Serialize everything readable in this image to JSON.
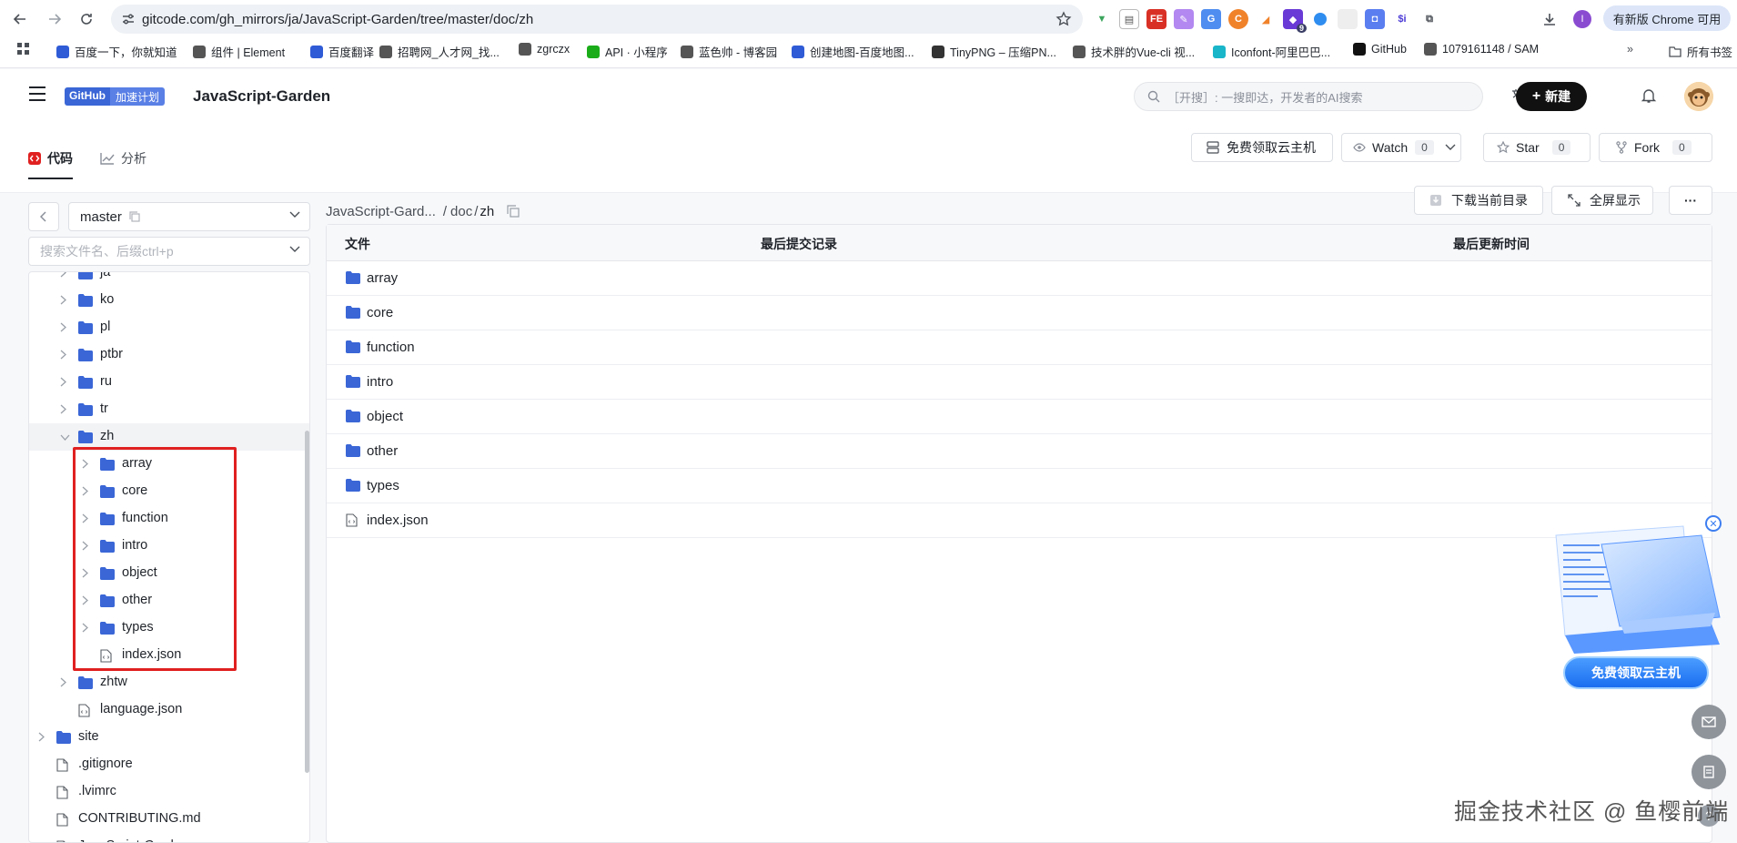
{
  "browser": {
    "url": "gitcode.com/gh_mirrors/ja/JavaScript-Garden/tree/master/doc/zh",
    "update_badge": "有新版 Chrome 可用",
    "ext_badge_count": "9",
    "bookmarks": [
      {
        "label": "百度一下，你就知道",
        "color": "#2f5bd6"
      },
      {
        "label": "组件 | Element",
        "color": "#555"
      },
      {
        "label": "百度翻译",
        "color": "#2f5bd6"
      },
      {
        "label": "招聘网_人才网_找...",
        "color": "#555"
      },
      {
        "label": "zgrczx",
        "color": "#555"
      },
      {
        "label": "API · 小程序",
        "color": "#1aad19"
      },
      {
        "label": "蓝色帅 - 博客园",
        "color": "#555"
      },
      {
        "label": "创建地图-百度地图...",
        "color": "#2f5bd6"
      },
      {
        "label": "TinyPNG – 压缩PN...",
        "color": "#333"
      },
      {
        "label": "技术胖的Vue-cli 视...",
        "color": "#555"
      },
      {
        "label": "Iconfont-阿里巴巴...",
        "color": "#19b5c9"
      },
      {
        "label": "GitHub",
        "color": "#111"
      },
      {
        "label": "1079161148 / SAM",
        "color": "#555"
      }
    ],
    "all_bookmarks": "所有书签"
  },
  "header": {
    "github_badge": "GitHub",
    "accel_badge": "加速计划",
    "repo_name": "JavaScript-Garden",
    "search_placeholder": "［开搜］: 一搜即达，开发者的AI搜索",
    "new_button": "新建"
  },
  "tabs": [
    {
      "label": "代码",
      "active": true
    },
    {
      "label": "分析",
      "active": false
    }
  ],
  "repo_actions": {
    "cloud": "免费领取云主机",
    "watch": "Watch",
    "watch_count": "0",
    "star": "Star",
    "star_count": "0",
    "fork": "Fork",
    "fork_count": "0"
  },
  "sidebar": {
    "branch": "master",
    "file_search_placeholder": "搜索文件名、后缀ctrl+p",
    "tree": [
      {
        "label": "ja",
        "type": "folder",
        "depth": 1
      },
      {
        "label": "ko",
        "type": "folder",
        "depth": 1
      },
      {
        "label": "pl",
        "type": "folder",
        "depth": 1
      },
      {
        "label": "ptbr",
        "type": "folder",
        "depth": 1
      },
      {
        "label": "ru",
        "type": "folder",
        "depth": 1
      },
      {
        "label": "tr",
        "type": "folder",
        "depth": 1
      },
      {
        "label": "zh",
        "type": "folder",
        "depth": 1,
        "expanded": true
      },
      {
        "label": "array",
        "type": "folder",
        "depth": 2
      },
      {
        "label": "core",
        "type": "folder",
        "depth": 2
      },
      {
        "label": "function",
        "type": "folder",
        "depth": 2
      },
      {
        "label": "intro",
        "type": "folder",
        "depth": 2
      },
      {
        "label": "object",
        "type": "folder",
        "depth": 2
      },
      {
        "label": "other",
        "type": "folder",
        "depth": 2
      },
      {
        "label": "types",
        "type": "folder",
        "depth": 2
      },
      {
        "label": "index.json",
        "type": "json",
        "depth": 2
      },
      {
        "label": "zhtw",
        "type": "folder",
        "depth": 1
      },
      {
        "label": "language.json",
        "type": "json",
        "depth": 1
      },
      {
        "label": "site",
        "type": "folder",
        "depth": 0
      },
      {
        "label": ".gitignore",
        "type": "file",
        "depth": 0
      },
      {
        "label": ".lvimrc",
        "type": "file",
        "depth": 0
      },
      {
        "label": "CONTRIBUTING.md",
        "type": "file",
        "depth": 0
      },
      {
        "label": "JavaScript-Garden",
        "type": "file",
        "depth": 0
      }
    ]
  },
  "breadcrumb": {
    "root": "JavaScript-Gard...",
    "sep1": "/",
    "part1": "doc",
    "sep2": "/",
    "current": "zh"
  },
  "main_actions": {
    "download": "下载当前目录",
    "fullscreen": "全屏显示",
    "more": "···"
  },
  "files": {
    "columns": [
      "文件",
      "最后提交记录",
      "最后更新时间"
    ],
    "rows": [
      {
        "name": "array",
        "type": "folder"
      },
      {
        "name": "core",
        "type": "folder"
      },
      {
        "name": "function",
        "type": "folder"
      },
      {
        "name": "intro",
        "type": "folder"
      },
      {
        "name": "object",
        "type": "folder"
      },
      {
        "name": "other",
        "type": "folder"
      },
      {
        "name": "types",
        "type": "folder"
      },
      {
        "name": "index.json",
        "type": "json"
      }
    ]
  },
  "ad": {
    "button": "免费领取云主机"
  },
  "watermark": "掘金技术社区 @ 鱼樱前端",
  "colors": {
    "folder": "#3a66d6",
    "highlight": "#e02020",
    "accent": "#111111"
  }
}
